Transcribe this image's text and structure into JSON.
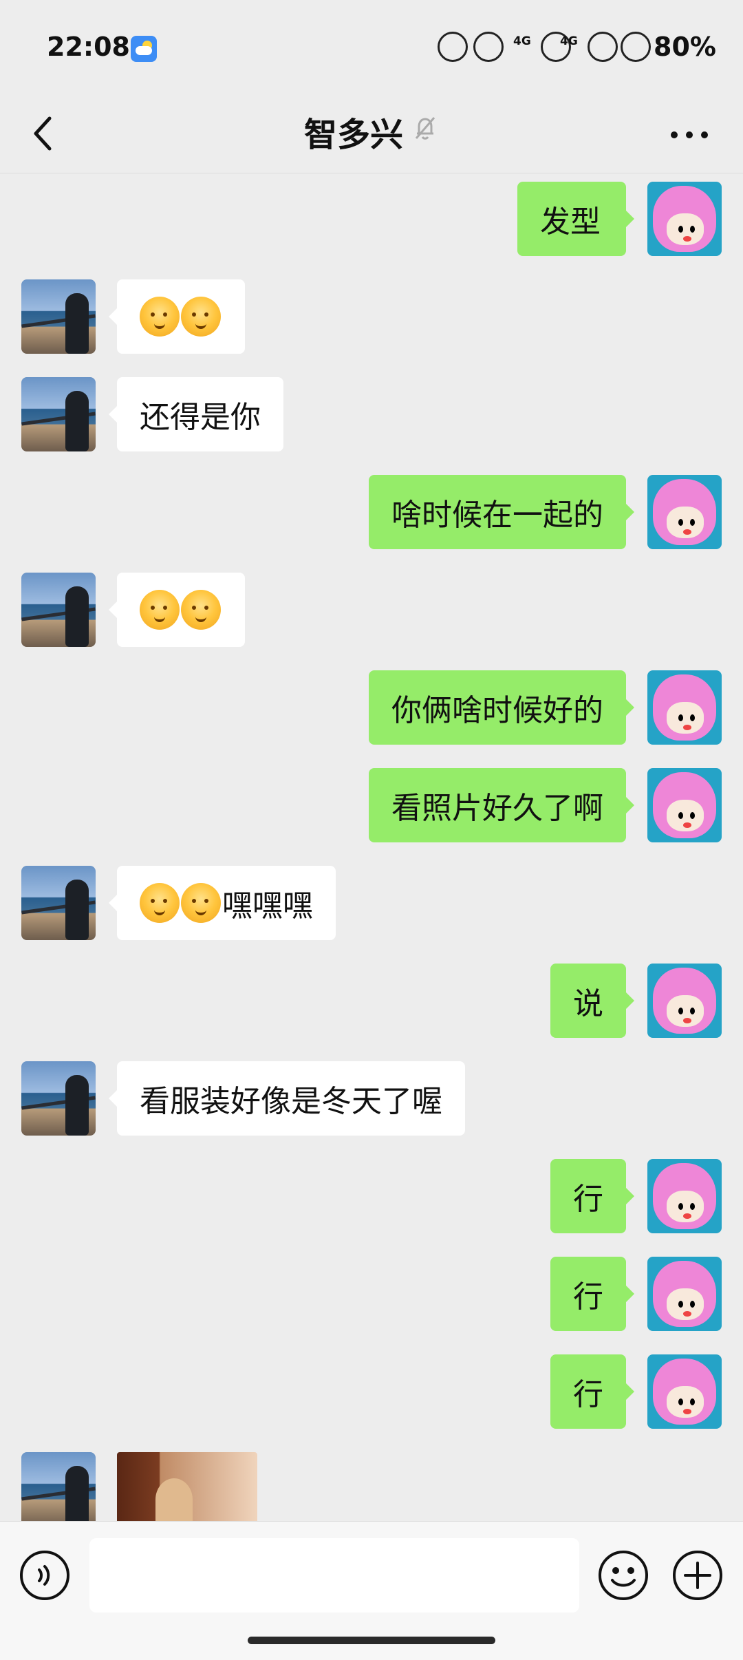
{
  "status_bar": {
    "time": "22:08",
    "battery": "80%",
    "network_labels": [
      "4G",
      "4G"
    ],
    "weather_icon": "weather-icon"
  },
  "header": {
    "title": "智多兴",
    "back_icon": "chevron-left-icon",
    "mute_icon": "bell-muted-icon",
    "more_icon": "more-horizontal-icon"
  },
  "messages": [
    {
      "side": "right",
      "type": "text",
      "text": "发型"
    },
    {
      "side": "left",
      "type": "emoji_text",
      "emoji_count": 2,
      "text": ""
    },
    {
      "side": "left",
      "type": "text",
      "text": "还得是你"
    },
    {
      "side": "right",
      "type": "text",
      "text": "啥时候在一起的"
    },
    {
      "side": "left",
      "type": "emoji_text",
      "emoji_count": 2,
      "text": ""
    },
    {
      "side": "right",
      "type": "text",
      "text": "你俩啥时候好的"
    },
    {
      "side": "right",
      "type": "text",
      "text": "看照片好久了啊"
    },
    {
      "side": "left",
      "type": "emoji_text",
      "emoji_count": 2,
      "text": "嘿嘿嘿"
    },
    {
      "side": "right",
      "type": "text",
      "text": "说"
    },
    {
      "side": "left",
      "type": "text",
      "text": "看服装好像是冬天了喔"
    },
    {
      "side": "right",
      "type": "text",
      "text": "行"
    },
    {
      "side": "right",
      "type": "text",
      "text": "行"
    },
    {
      "side": "right",
      "type": "text",
      "text": "行"
    },
    {
      "side": "left",
      "type": "image",
      "text": ""
    }
  ],
  "input_bar": {
    "voice_icon": "voice-icon",
    "emoji_icon": "emoji-icon",
    "plus_icon": "plus-icon",
    "placeholder": ""
  },
  "colors": {
    "background": "#ededed",
    "incoming_bubble": "#ffffff",
    "outgoing_bubble": "#95ec69",
    "input_bar": "#f7f7f7"
  }
}
